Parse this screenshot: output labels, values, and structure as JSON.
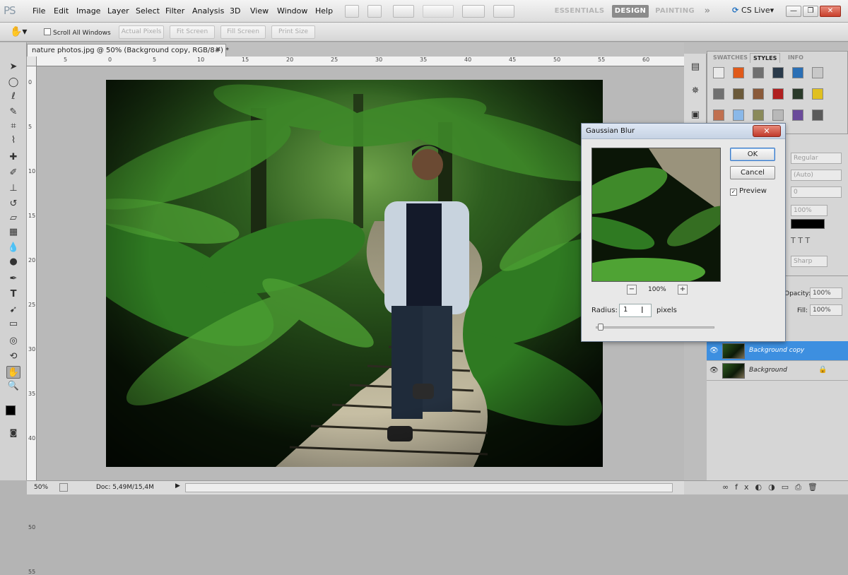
{
  "app": {
    "logo": "PS"
  },
  "menu": [
    "File",
    "Edit",
    "Image",
    "Layer",
    "Select",
    "Filter",
    "Analysis",
    "3D",
    "View",
    "Window",
    "Help"
  ],
  "workspaces": {
    "essentials": "ESSENTIALS",
    "design": "DESIGN",
    "painting": "PAINTING",
    "more": "»"
  },
  "cslive": "CS Live▾",
  "options": {
    "scroll_all": "Scroll All Windows",
    "actual_pixels": "Actual Pixels",
    "fit_screen": "Fit Screen",
    "fill_screen": "Fill Screen",
    "print_size": "Print Size"
  },
  "document": {
    "tab_title": "nature photos.jpg @ 50% (Background copy, RGB/8#) *",
    "ruler_h": [
      "5",
      "0",
      "5",
      "10",
      "15",
      "20",
      "25",
      "30",
      "35",
      "40",
      "45",
      "50",
      "55",
      "60"
    ],
    "ruler_v": [
      "0",
      "5",
      "10",
      "15",
      "20",
      "25",
      "30",
      "35",
      "40",
      "45",
      "50",
      "55"
    ],
    "zoom": "50%",
    "doc_info": "Doc: 5,49M/15,4M"
  },
  "panels": {
    "tabs": [
      "SWATCHES",
      "STYLES",
      "INFO"
    ],
    "active_tab": "STYLES",
    "char": {
      "style": "Regular",
      "leading": "(Auto)",
      "tracking": "0",
      "scale": "100%",
      "aa": "Sharp"
    },
    "layers": {
      "opacity_label": "Opacity:",
      "opacity": "100%",
      "fill_label": "Fill:",
      "fill": "100%",
      "items": [
        {
          "name": "Background copy",
          "selected": true
        },
        {
          "name": "Background",
          "selected": false
        }
      ]
    }
  },
  "dialog": {
    "title": "Gaussian Blur",
    "ok": "OK",
    "cancel": "Cancel",
    "preview_label": "Preview",
    "preview_checked": true,
    "zoom": "100%",
    "radius_label": "Radius:",
    "radius_value": "1",
    "unit": "pixels",
    "slider_level": 0.02
  }
}
